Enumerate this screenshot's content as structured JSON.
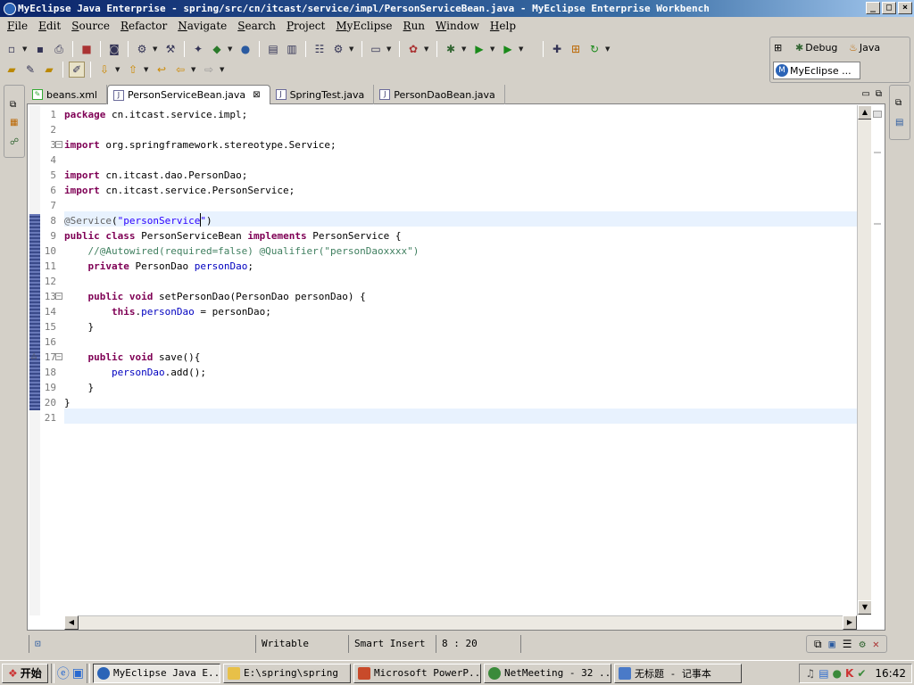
{
  "window": {
    "title": "MyEclipse Java Enterprise - spring/src/cn/itcast/service/impl/PersonServiceBean.java - MyEclipse Enterprise Workbench"
  },
  "menu": [
    "File",
    "Edit",
    "Source",
    "Refactor",
    "Navigate",
    "Search",
    "Project",
    "MyEclipse",
    "Run",
    "Window",
    "Help"
  ],
  "perspectives": {
    "debug": "Debug",
    "java": "Java",
    "myeclipse": "MyEclipse ..."
  },
  "tabs": [
    {
      "label": "beans.xml",
      "active": false
    },
    {
      "label": "PersonServiceBean.java",
      "active": true
    },
    {
      "label": "SpringTest.java",
      "active": false
    },
    {
      "label": "PersonDaoBean.java",
      "active": false
    }
  ],
  "code": [
    "package cn.itcast.service.impl;",
    "",
    "import org.springframework.stereotype.Service;",
    "",
    "import cn.itcast.dao.PersonDao;",
    "import cn.itcast.service.PersonService;",
    "",
    "@Service(\"personService\")",
    "public class PersonServiceBean implements PersonService {",
    "    //@Autowired(required=false) @Qualifier(\"personDaoxxxx\")",
    "    private PersonDao personDao;",
    "",
    "    public void setPersonDao(PersonDao personDao) {",
    "        this.personDao = personDao;",
    "    }",
    "",
    "    public void save(){",
    "        personDao.add();",
    "    }",
    "}",
    ""
  ],
  "status": {
    "writable": "Writable",
    "mode": "Smart Insert",
    "position": "8 : 20"
  },
  "taskbar": {
    "start": "开始",
    "tasks": [
      "MyEclipse Java E...",
      "E:\\spring\\spring",
      "Microsoft PowerP...",
      "NetMeeting - 32 ...",
      "无标题 - 记事本"
    ],
    "clock": "16:42"
  },
  "colors": {
    "keyword": "#7f0055",
    "string": "#2a00ff",
    "field": "#0000c0",
    "comment": "#3f7f5f",
    "titlebar": "#0a246a"
  }
}
